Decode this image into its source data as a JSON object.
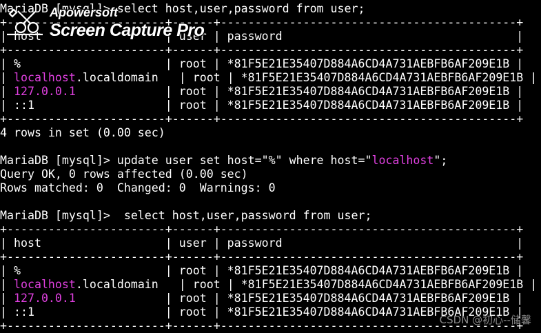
{
  "terminal": {
    "lines": [
      [
        {
          "t": "MariaDB [mysql]> select host,user,password from user;"
        }
      ],
      [
        {
          "t": "+-----------------------+------+-------------------------------------------+"
        }
      ],
      [
        {
          "t": "| host                  | user | password                                  |"
        }
      ],
      [
        {
          "t": "+-----------------------+------+-------------------------------------------+"
        }
      ],
      [
        {
          "t": "| %                     | root | *81F5E21E35407D884A6CD4A731AEBFB6AF209E1B |"
        }
      ],
      [
        {
          "t": "| "
        },
        {
          "t": "localhost",
          "c": "mag"
        },
        {
          "t": ".localdomain   | root | *81F5E21E35407D884A6CD4A731AEBFB6AF209E1B |"
        }
      ],
      [
        {
          "t": "| "
        },
        {
          "t": "127.0.0.1",
          "c": "mag"
        },
        {
          "t": "             | root | *81F5E21E35407D884A6CD4A731AEBFB6AF209E1B |"
        }
      ],
      [
        {
          "t": "| ::1                   | root | *81F5E21E35407D884A6CD4A731AEBFB6AF209E1B |"
        }
      ],
      [
        {
          "t": "+-----------------------+------+-------------------------------------------+"
        }
      ],
      [
        {
          "t": "4 rows in set (0.00 sec)"
        }
      ],
      [
        {
          "t": ""
        }
      ],
      [
        {
          "t": "MariaDB [mysql]> update user set host=\"%\" where host=\""
        },
        {
          "t": "localhost",
          "c": "mag"
        },
        {
          "t": "\";"
        }
      ],
      [
        {
          "t": "Query OK, 0 rows affected (0.00 sec)"
        }
      ],
      [
        {
          "t": "Rows matched: 0  Changed: 0  Warnings: 0"
        }
      ],
      [
        {
          "t": ""
        }
      ],
      [
        {
          "t": "MariaDB [mysql]>  select host,user,password from user;"
        }
      ],
      [
        {
          "t": "+-----------------------+------+-------------------------------------------+"
        }
      ],
      [
        {
          "t": "| host                  | user | password                                  |"
        }
      ],
      [
        {
          "t": "+-----------------------+------+-------------------------------------------+"
        }
      ],
      [
        {
          "t": "| %                     | root | *81F5E21E35407D884A6CD4A731AEBFB6AF209E1B |"
        }
      ],
      [
        {
          "t": "| "
        },
        {
          "t": "localhost",
          "c": "mag"
        },
        {
          "t": ".localdomain   | root | *81F5E21E35407D884A6CD4A731AEBFB6AF209E1B |"
        }
      ],
      [
        {
          "t": "| "
        },
        {
          "t": "127.0.0.1",
          "c": "mag"
        },
        {
          "t": "             | root | *81F5E21E35407D884A6CD4A731AEBFB6AF209E1B |"
        }
      ],
      [
        {
          "t": "| ::1                   | root | *81F5E21E35407D884A6CD4A731AEBFB6AF209E1B |"
        }
      ],
      [
        {
          "t": "+-----------------------+------+-------------------------------------------+"
        }
      ]
    ]
  },
  "watermark": {
    "brand": "Apowersoft",
    "product": "Screen Capture Pro",
    "icon": "scissors-logo-icon"
  },
  "footer": {
    "csdn": "CSDN @初心--储馨"
  },
  "colors": {
    "background": "#000000",
    "text": "#ffffff",
    "highlight": "#e040e0"
  }
}
